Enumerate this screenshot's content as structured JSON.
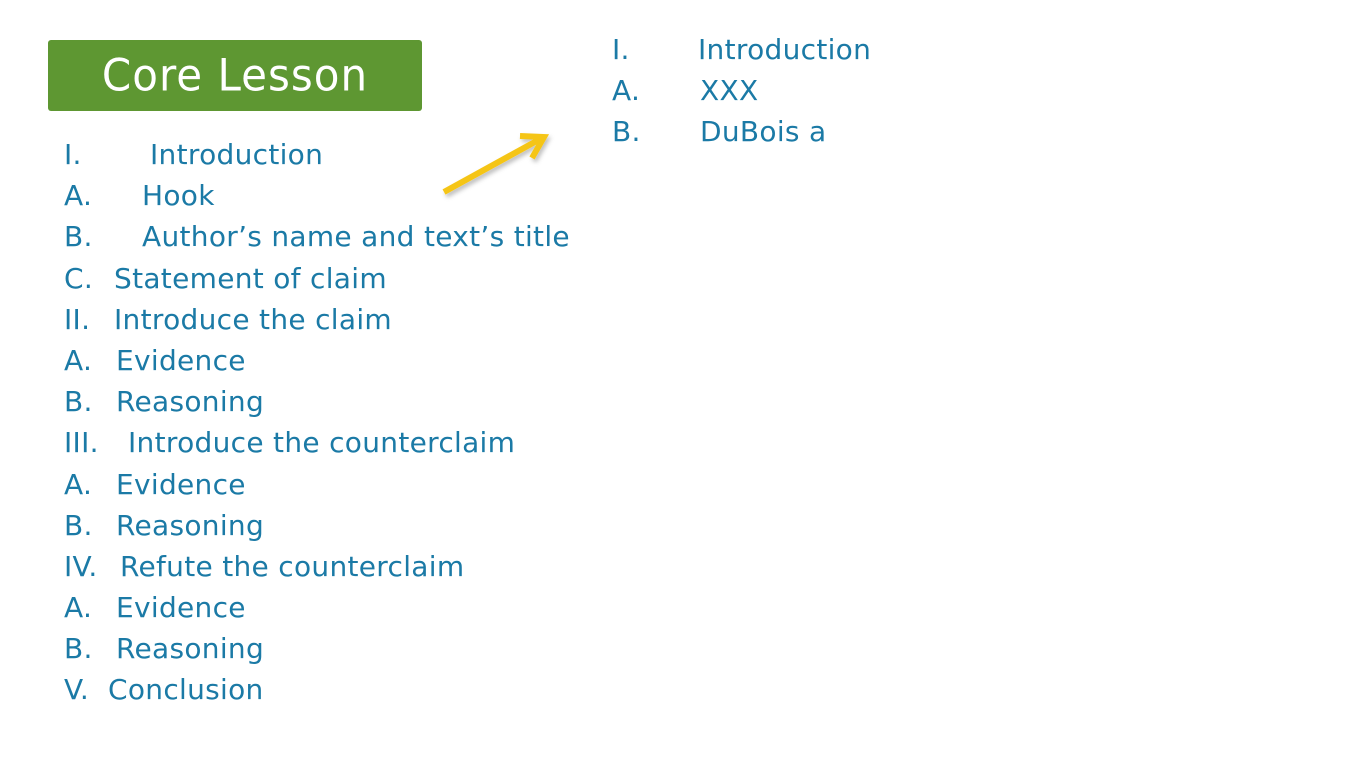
{
  "title": "Core Lesson",
  "colors": {
    "title_bg": "#5e9732",
    "title_text": "#ffffff",
    "outline_text": "#1b7aa6",
    "arrow": "#f5c518"
  },
  "left_outline": [
    {
      "marker": "I.",
      "text": "Introduction"
    },
    {
      "marker": "A.",
      "text": "Hook"
    },
    {
      "marker": "B.",
      "text": "Author’s name and text’s title"
    },
    {
      "marker": "C.",
      "text": "Statement of claim"
    },
    {
      "marker": "II.",
      "text": "Introduce the claim"
    },
    {
      "marker": "A.",
      "text": "Evidence"
    },
    {
      "marker": "B.",
      "text": "Reasoning"
    },
    {
      "marker": "III.",
      "text": "Introduce the counterclaim"
    },
    {
      "marker": "A.",
      "text": "Evidence"
    },
    {
      "marker": "B.",
      "text": "Reasoning"
    },
    {
      "marker": "IV.",
      "text": "Refute the counterclaim"
    },
    {
      "marker": "A.",
      "text": "Evidence"
    },
    {
      "marker": "B.",
      "text": "Reasoning"
    },
    {
      "marker": "V.",
      "text": "Conclusion"
    }
  ],
  "right_outline": [
    {
      "marker": "I.",
      "text": "Introduction"
    },
    {
      "marker": "A.",
      "text": "XXX"
    },
    {
      "marker": "B.",
      "text": "DuBois a"
    }
  ],
  "arrow_icon": "arrow-up-right-icon"
}
